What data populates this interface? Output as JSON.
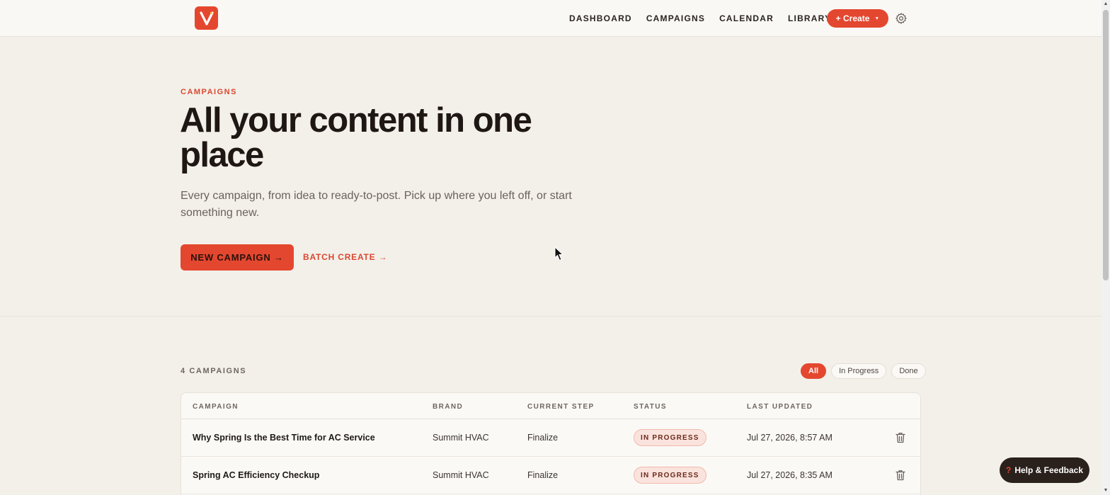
{
  "nav": {
    "links": [
      "DASHBOARD",
      "CAMPAIGNS",
      "CALENDAR",
      "LIBRARY"
    ],
    "create_label": "+ Create",
    "logo_letter": "V"
  },
  "hero": {
    "eyebrow": "CAMPAIGNS",
    "headline": "All your content in one place",
    "subtitle": "Every campaign, from idea to ready-to-post. Pick up where you left off, or start something new.",
    "primary_button": "NEW CAMPAIGN →",
    "secondary_link": "BATCH CREATE →"
  },
  "campaigns": {
    "count_label": "4 CAMPAIGNS",
    "filters": [
      "All",
      "In Progress",
      "Done"
    ],
    "active_filter": "All",
    "columns": [
      "CAMPAIGN",
      "BRAND",
      "CURRENT STEP",
      "STATUS",
      "LAST UPDATED"
    ],
    "rows": [
      {
        "campaign": "Why Spring Is the Best Time for AC Service",
        "brand": "Summit HVAC",
        "step": "Finalize",
        "status": "IN PROGRESS",
        "updated": "Jul 27, 2026, 8:57 AM"
      },
      {
        "campaign": "Spring AC Efficiency Checkup",
        "brand": "Summit HVAC",
        "step": "Finalize",
        "status": "IN PROGRESS",
        "updated": "Jul 27, 2026, 8:35 AM"
      }
    ]
  },
  "help": {
    "icon": "?",
    "label": "Help & Feedback"
  },
  "colors": {
    "accent": "#e4472f",
    "background": "#f3f0ea",
    "dark": "#1f1714"
  }
}
